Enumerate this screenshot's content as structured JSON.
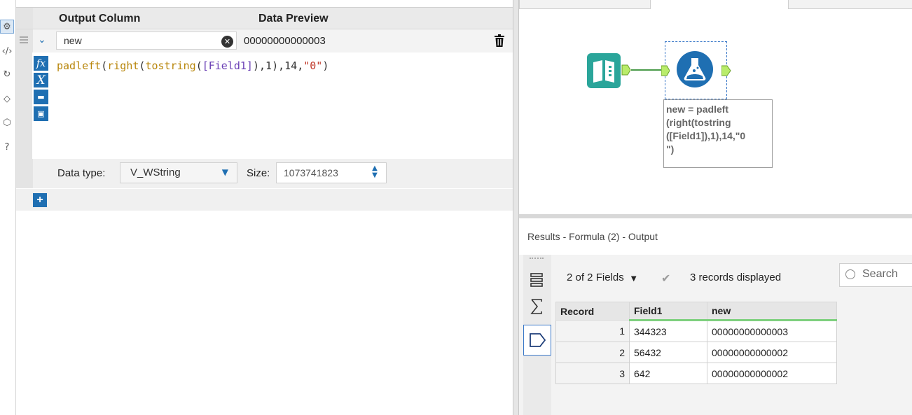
{
  "config": {
    "headers": {
      "output_column": "Output Column",
      "data_preview": "Data Preview"
    },
    "row": {
      "output_column_value": "new",
      "preview_value": "00000000000003"
    },
    "expression": {
      "tokens": [
        {
          "text": "padleft",
          "color": "#b8860b"
        },
        {
          "text": "(",
          "color": "#333333"
        },
        {
          "text": "right",
          "color": "#b8860b"
        },
        {
          "text": "(",
          "color": "#333333"
        },
        {
          "text": "tostring",
          "color": "#b8860b"
        },
        {
          "text": "(",
          "color": "#333333"
        },
        {
          "text": "[Field1]",
          "color": "#6a3fb5"
        },
        {
          "text": "),",
          "color": "#333333"
        },
        {
          "text": "1",
          "color": "#333333"
        },
        {
          "text": "),",
          "color": "#333333"
        },
        {
          "text": "14",
          "color": "#333333"
        },
        {
          "text": ",",
          "color": "#333333"
        },
        {
          "text": "\"0\"",
          "color": "#c0392b"
        },
        {
          "text": ")",
          "color": "#333333"
        }
      ]
    },
    "data_type_label": "Data type:",
    "data_type_value": "V_WString",
    "size_label": "Size:",
    "size_value": "1073741823",
    "add_label": "+"
  },
  "canvas": {
    "annotation_lines": [
      "new = padleft",
      "(right(tostring",
      "([Field1]),1),14,\"0",
      "\")"
    ]
  },
  "results": {
    "title": "Results - Formula (2) - Output",
    "fields_label": "2 of 2 Fields",
    "records_label": "3 records displayed",
    "search_placeholder": "Search",
    "columns": [
      "Record",
      "Field1",
      "new"
    ],
    "rows": [
      [
        "1",
        "344323",
        "00000000000003"
      ],
      [
        "2",
        "56432",
        "00000000000002"
      ],
      [
        "3",
        "642",
        "00000000000002"
      ]
    ]
  },
  "colors": {
    "accent": "#1f6fb2",
    "connector": "#7ecb6b",
    "input_tool": "#2aa59a"
  },
  "icons": [
    "gear-icon",
    "code-icon",
    "refresh-icon",
    "tag-icon",
    "cube-icon",
    "help-icon",
    "clear-icon",
    "trash-icon",
    "fx-icon",
    "variable-icon",
    "open-icon",
    "save-icon",
    "input-data-icon",
    "formula-icon",
    "search-icon",
    "check-icon"
  ]
}
